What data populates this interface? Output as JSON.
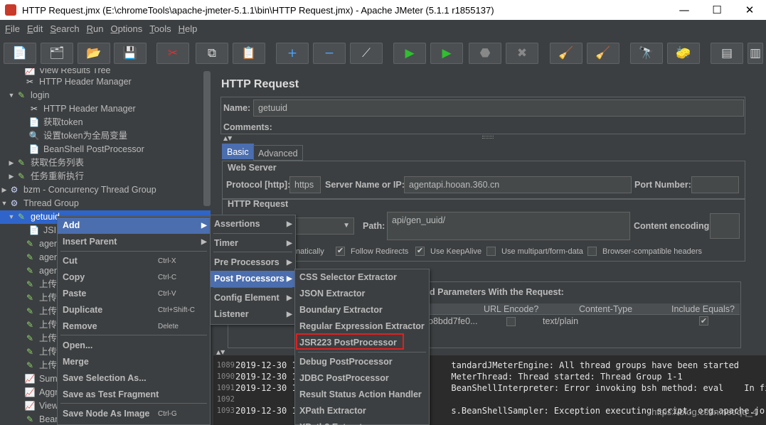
{
  "window": {
    "title": "HTTP Request.jmx (E:\\chromeTools\\apache-jmeter-5.1.1\\bin\\HTTP Request.jmx) - Apache JMeter (5.1.1 r1855137)",
    "minimize": "—",
    "maximize": "☐",
    "close": "✕"
  },
  "menubar": [
    "File",
    "Edit",
    "Search",
    "Run",
    "Options",
    "Tools",
    "Help"
  ],
  "toolbar": [
    {
      "name": "new-icon",
      "glyph": "📄"
    },
    {
      "name": "templates-icon",
      "glyph": "🗂"
    },
    {
      "name": "open-icon",
      "glyph": "📂"
    },
    {
      "name": "save-icon",
      "glyph": "💾"
    },
    {
      "name": "cut-icon",
      "glyph": "✂"
    },
    {
      "name": "copy-icon",
      "glyph": "⧉"
    },
    {
      "name": "paste-icon",
      "glyph": "📋"
    },
    {
      "name": "expand-icon",
      "glyph": "+"
    },
    {
      "name": "collapse-icon",
      "glyph": "−"
    },
    {
      "name": "toggle-icon",
      "glyph": "⟋"
    },
    {
      "name": "start-icon",
      "glyph": "▶"
    },
    {
      "name": "start-no-pauses-icon",
      "glyph": "▶"
    },
    {
      "name": "stop-icon",
      "glyph": "⬣"
    },
    {
      "name": "shutdown-icon",
      "glyph": "✖"
    },
    {
      "name": "clear-icon",
      "glyph": "🧹"
    },
    {
      "name": "clear-all-icon",
      "glyph": "🧹"
    },
    {
      "name": "search-icon",
      "glyph": "🔭"
    },
    {
      "name": "reset-search-icon",
      "glyph": "🧽"
    },
    {
      "name": "function-helper-icon",
      "glyph": "▤"
    },
    {
      "name": "help-icon",
      "glyph": "▥"
    }
  ],
  "tree": {
    "items": [
      {
        "label": "View Results Tree",
        "icon": "chart-icon"
      },
      {
        "label": "HTTP Header Manager",
        "icon": "wrench-icon"
      },
      {
        "label": "login",
        "icon": "pencil-icon"
      },
      {
        "label": "HTTP Header Manager",
        "icon": "wrench-icon"
      },
      {
        "label": "获取token",
        "icon": "script-icon"
      },
      {
        "label": "设置token为全局变量",
        "icon": "user-icon"
      },
      {
        "label": "BeanShell PostProcessor",
        "icon": "script-icon"
      },
      {
        "label": "获取任务列表",
        "icon": "pencil-icon"
      },
      {
        "label": "任务重新执行",
        "icon": "pencil-icon"
      },
      {
        "label": "bzm - Concurrency Thread Group",
        "icon": "gear-icon"
      },
      {
        "label": "Thread Group",
        "icon": "gear-icon"
      },
      {
        "label": "getuuid",
        "icon": "pencil-icon"
      },
      {
        "label": "JSI",
        "icon": "script-icon"
      },
      {
        "label": "agen",
        "icon": "pencil-icon"
      },
      {
        "label": "agen",
        "icon": "pencil-icon"
      },
      {
        "label": "agen",
        "icon": "pencil-icon"
      },
      {
        "label": "上传",
        "icon": "pencil-icon"
      },
      {
        "label": "上传",
        "icon": "pencil-icon"
      },
      {
        "label": "上传",
        "icon": "pencil-icon"
      },
      {
        "label": "上传",
        "icon": "pencil-icon"
      },
      {
        "label": "上传",
        "icon": "pencil-icon"
      },
      {
        "label": "上传",
        "icon": "pencil-icon"
      },
      {
        "label": "上传",
        "icon": "pencil-icon"
      },
      {
        "label": "Sum",
        "icon": "chart-icon"
      },
      {
        "label": "Aggr",
        "icon": "chart-icon"
      },
      {
        "label": "View",
        "icon": "chart-icon"
      },
      {
        "label": "Bean",
        "icon": "pencil-icon"
      }
    ]
  },
  "panel": {
    "title": "HTTP Request",
    "name_label": "Name:",
    "name_value": "getuuid",
    "comments_label": "Comments:",
    "tabs": [
      "Basic",
      "Advanced"
    ],
    "web_server_title": "Web Server",
    "protocol_label": "Protocol [http]:",
    "protocol_value": "https",
    "server_label": "Server Name or IP:",
    "server_value": "agentapi.hooan.360.cn",
    "port_label": "Port Number:",
    "port_value": "",
    "http_request_title": "HTTP Request",
    "path_label": "Path:",
    "path_value": "api/gen_uuid/",
    "encoding_label": "Content encoding:",
    "encoding_value": "",
    "follow_redirects_partial": "natically",
    "checkboxes": [
      {
        "label": "Follow Redirects",
        "checked": true
      },
      {
        "label": "Use KeepAlive",
        "checked": true
      },
      {
        "label": "Use multipart/form-data",
        "checked": false
      },
      {
        "label": "Browser-compatible headers",
        "checked": false
      }
    ],
    "params_title_partial": "d Parameters With the Request:",
    "table_headers": [
      "URL Encode?",
      "Content-Type",
      "Include Equals?"
    ],
    "table_row": {
      "value_partial": "b8bdd7fe0...",
      "url_encode": false,
      "content_type": "text/plain",
      "include_equals": true
    }
  },
  "log": {
    "lines": [
      {
        "num": "1089",
        "text": "2019-12-30 1                              tandardJMeterEngine: All thread groups have been started"
      },
      {
        "num": "1090",
        "text": "2019-12-30 1                              MeterThread: Thread started: Thread Group 1-1"
      },
      {
        "num": "1091",
        "text": "2019-12-30 1                              BeanShellInterpreter: Error invoking bsh method: eval    In file:"
      },
      {
        "num": "1092",
        "text": ""
      },
      {
        "num": "1093",
        "text": "2019-12-30 1                              s.BeanShellSampler: Exception executing script: org.apache.jorphan.util.JMeterStopTestException: Error invoking bsh"
      }
    ],
    "watermark": "https://blog.csdn.net/qq_4"
  },
  "context_menu": {
    "items": [
      {
        "label": "Add",
        "accel": "",
        "submenu": true
      },
      {
        "label": "Insert Parent",
        "accel": "",
        "submenu": true
      },
      {
        "label": "Cut",
        "accel": "Ctrl-X",
        "submenu": false
      },
      {
        "label": "Copy",
        "accel": "Ctrl-C",
        "submenu": false
      },
      {
        "label": "Paste",
        "accel": "Ctrl-V",
        "submenu": false
      },
      {
        "label": "Duplicate",
        "accel": "Ctrl+Shift-C",
        "submenu": false
      },
      {
        "label": "Remove",
        "accel": "Delete",
        "submenu": false
      },
      {
        "label": "Open...",
        "accel": "",
        "submenu": false
      },
      {
        "label": "Merge",
        "accel": "",
        "submenu": false
      },
      {
        "label": "Save Selection As...",
        "accel": "",
        "submenu": false
      },
      {
        "label": "Save as Test Fragment",
        "accel": "",
        "submenu": false
      },
      {
        "label": "Save Node As Image",
        "accel": "Ctrl-G",
        "submenu": false
      }
    ]
  },
  "add_submenu": {
    "items": [
      "Assertions",
      "Timer",
      "Pre Processors",
      "Post Processors",
      "Config Element",
      "Listener"
    ]
  },
  "post_processors_submenu": {
    "items": [
      "CSS Selector Extractor",
      "JSON Extractor",
      "Boundary Extractor",
      "Regular Expression Extractor",
      "JSR223 PostProcessor",
      "Debug PostProcessor",
      "JDBC PostProcessor",
      "Result Status Action Handler",
      "XPath Extractor",
      "XPath2 Extractor"
    ],
    "highlighted": "JSR223 PostProcessor"
  },
  "colors": {
    "background": "#3c3f41",
    "selection": "#4b6eaf",
    "highlight_box": "#e02020"
  }
}
